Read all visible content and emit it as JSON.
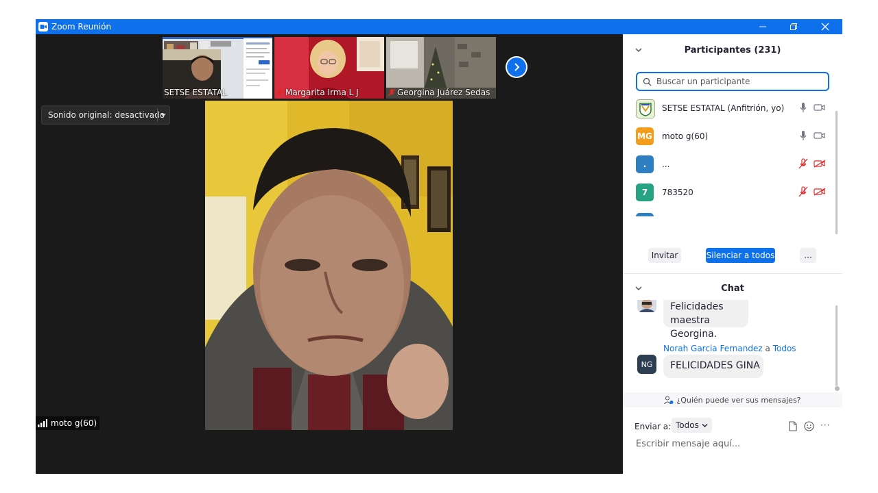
{
  "window": {
    "title": "Zoom Reunión"
  },
  "stage": {
    "thumbnails": [
      {
        "name": "SETSE ESTATAL",
        "muted": false
      },
      {
        "name": "Margarita Irma L J",
        "muted": true
      },
      {
        "name": "Georgina Juárez Sedas",
        "muted": true
      }
    ],
    "sound_original_label": "Sonido original: desactivado",
    "speaker_name": "moto g(60)"
  },
  "participants": {
    "header": "Participantes (231)",
    "search_placeholder": "Buscar un participante",
    "list": [
      {
        "initials": "",
        "name": "SETSE ESTATAL (Anfitrión, yo)",
        "avatar_color": "#e9f2d8",
        "audio": "on",
        "video": "off"
      },
      {
        "initials": "MG",
        "name": "moto g(60)",
        "avatar_color": "#f29d1c",
        "audio": "on",
        "video": "off"
      },
      {
        "initials": ".",
        "name": "...",
        "avatar_color": "#2d7fc1",
        "audio": "muted",
        "video": "muted"
      },
      {
        "initials": "7",
        "name": "783520",
        "avatar_color": "#27a383",
        "audio": "muted",
        "video": "muted"
      }
    ],
    "invite_label": "Invitar",
    "mute_all_label": "Silenciar a todos",
    "more_label": "..."
  },
  "chat": {
    "header": "Chat",
    "messages": [
      {
        "text_line1": "Felicidades maestra",
        "text_line2": "Georgina."
      },
      {
        "sender": "Norah Garcia Fernandez",
        "to_word": "a",
        "recipient": "Todos",
        "initials": "NG",
        "text": "FELICIDADES GINA"
      }
    ],
    "who_can_see": "¿Quién puede ver sus mensajes?",
    "send_to_label": "Enviar a:",
    "send_to_value": "Todos",
    "input_placeholder": "Escribir mensaje aquí...",
    "more_label": "···"
  },
  "colors": {
    "accent": "#0e71eb",
    "muted_red": "#e02828",
    "titlebar": "#0e71eb"
  }
}
